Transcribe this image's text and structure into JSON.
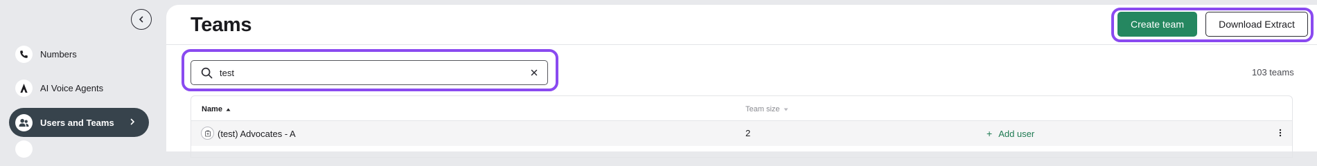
{
  "sidebar": {
    "items": [
      {
        "label": "Numbers",
        "icon": "phone-icon"
      },
      {
        "label": "AI Voice Agents",
        "icon": "ai-agent-icon"
      },
      {
        "label": "Users and Teams",
        "icon": "users-icon",
        "active": true
      }
    ]
  },
  "header": {
    "title": "Teams",
    "create_button": "Create team",
    "download_button": "Download Extract"
  },
  "search": {
    "value": "test",
    "placeholder": ""
  },
  "team_count": "103 teams",
  "table": {
    "columns": [
      "Name",
      "Team size"
    ],
    "rows": [
      {
        "name": "(test) Advocates - A",
        "size": "2",
        "action": "Add user"
      }
    ]
  },
  "colors": {
    "primary": "#258760",
    "active_nav": "#37434c",
    "highlight": "#8a4af0"
  }
}
